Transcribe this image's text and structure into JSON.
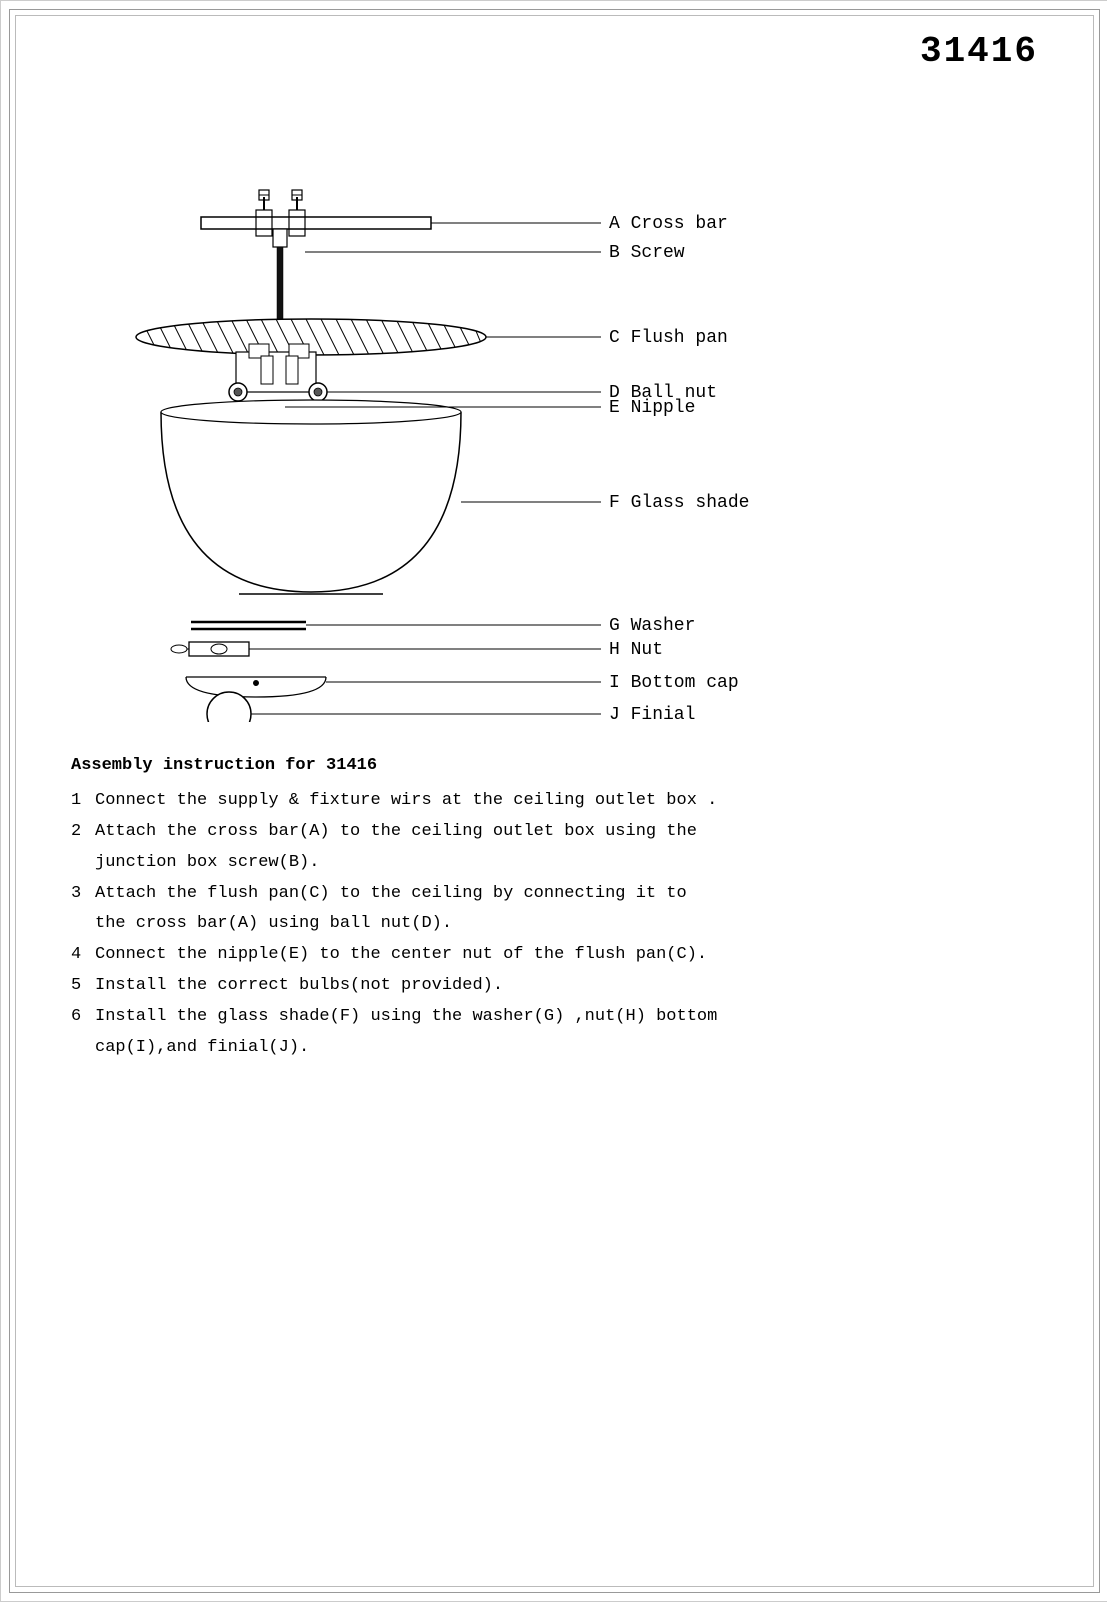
{
  "doc_number": "31416",
  "parts": [
    {
      "label": "A",
      "name": "Cross bar"
    },
    {
      "label": "B",
      "name": "Screw"
    },
    {
      "label": "C",
      "name": "Flush pan"
    },
    {
      "label": "D",
      "name": "Ball nut"
    },
    {
      "label": "E",
      "name": "Nipple"
    },
    {
      "label": "F",
      "name": "Glass shade"
    },
    {
      "label": "G",
      "name": "Washer"
    },
    {
      "label": "H",
      "name": "Nut"
    },
    {
      "label": "I",
      "name": "Bottom cap"
    },
    {
      "label": "J",
      "name": "Finial"
    }
  ],
  "instructions": {
    "title": "Assembly instruction for 31416",
    "steps": [
      {
        "num": "1",
        "text": "Connect the supply & fixture wirs at the ceiling outlet box .",
        "cont": null
      },
      {
        "num": "2",
        "text": "Attach the cross bar(A) to the ceiling outlet box using the",
        "cont": "junction box screw(B)."
      },
      {
        "num": "3",
        "text": "Attach the flush pan(C) to the ceiling by connecting it to",
        "cont": "the cross bar(A) using ball nut(D)."
      },
      {
        "num": "4",
        "text": "Connect the nipple(E) to the center nut of the flush pan(C).",
        "cont": null
      },
      {
        "num": "5",
        "text": "Install the correct bulbs(not  provided).",
        "cont": null
      },
      {
        "num": "6",
        "text": "Install the glass shade(F) using the washer(G) ,nut(H) bottom",
        "cont": "cap(I),and finial(J)."
      }
    ]
  }
}
